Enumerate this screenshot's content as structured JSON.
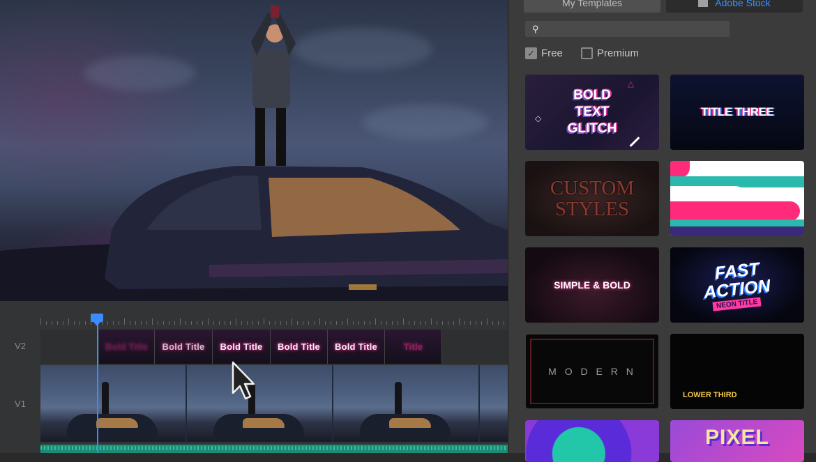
{
  "tracks": {
    "v2": "V2",
    "v1": "V1"
  },
  "title_clips": [
    "Bold Title",
    "Bold Title",
    "Bold Title",
    "Bold Title",
    "Bold Title",
    "Title"
  ],
  "panel": {
    "tabs": [
      "My Templates",
      "Adobe Stock"
    ],
    "search": {
      "placeholder": ""
    },
    "filters": [
      {
        "label": "Free",
        "checked": true
      },
      {
        "label": "Premium",
        "checked": false
      }
    ]
  },
  "templates": [
    {
      "name": "BOLD TEXT GLITCH",
      "lines": [
        "BOLD",
        "TEXT",
        "GLITCH"
      ]
    },
    {
      "name": "TITLE THREE",
      "lines": [
        "TITLE THREE"
      ]
    },
    {
      "name": "CUSTOM STYLES",
      "lines": [
        "CUSTOM",
        "STYLES"
      ]
    },
    {
      "name": "",
      "lines": []
    },
    {
      "name": "SIMPLE & BOLD",
      "lines": [
        "SIMPLE & BOLD"
      ]
    },
    {
      "name": "FAST ACTION",
      "lines": [
        "FAST",
        "ACTION",
        "NEON TITLE"
      ]
    },
    {
      "name": "MODERN",
      "lines": [
        "M O D E R N"
      ]
    },
    {
      "name": "LOWER THIRD",
      "lines": [
        "LOWER THIRD"
      ]
    },
    {
      "name": "",
      "lines": []
    },
    {
      "name": "PIXEL",
      "lines": [
        "PIXEL"
      ]
    }
  ],
  "colors": {
    "accent": "#3a92ff",
    "playhead": "#3a8cff",
    "audio": "#1d8c76",
    "neon_pink": "#e82e8a"
  },
  "icons": [
    "search-icon",
    "checkbox-checked-icon",
    "checkbox-empty-icon",
    "pencil-icon",
    "playhead-icon",
    "cursor-arrow-icon"
  ]
}
